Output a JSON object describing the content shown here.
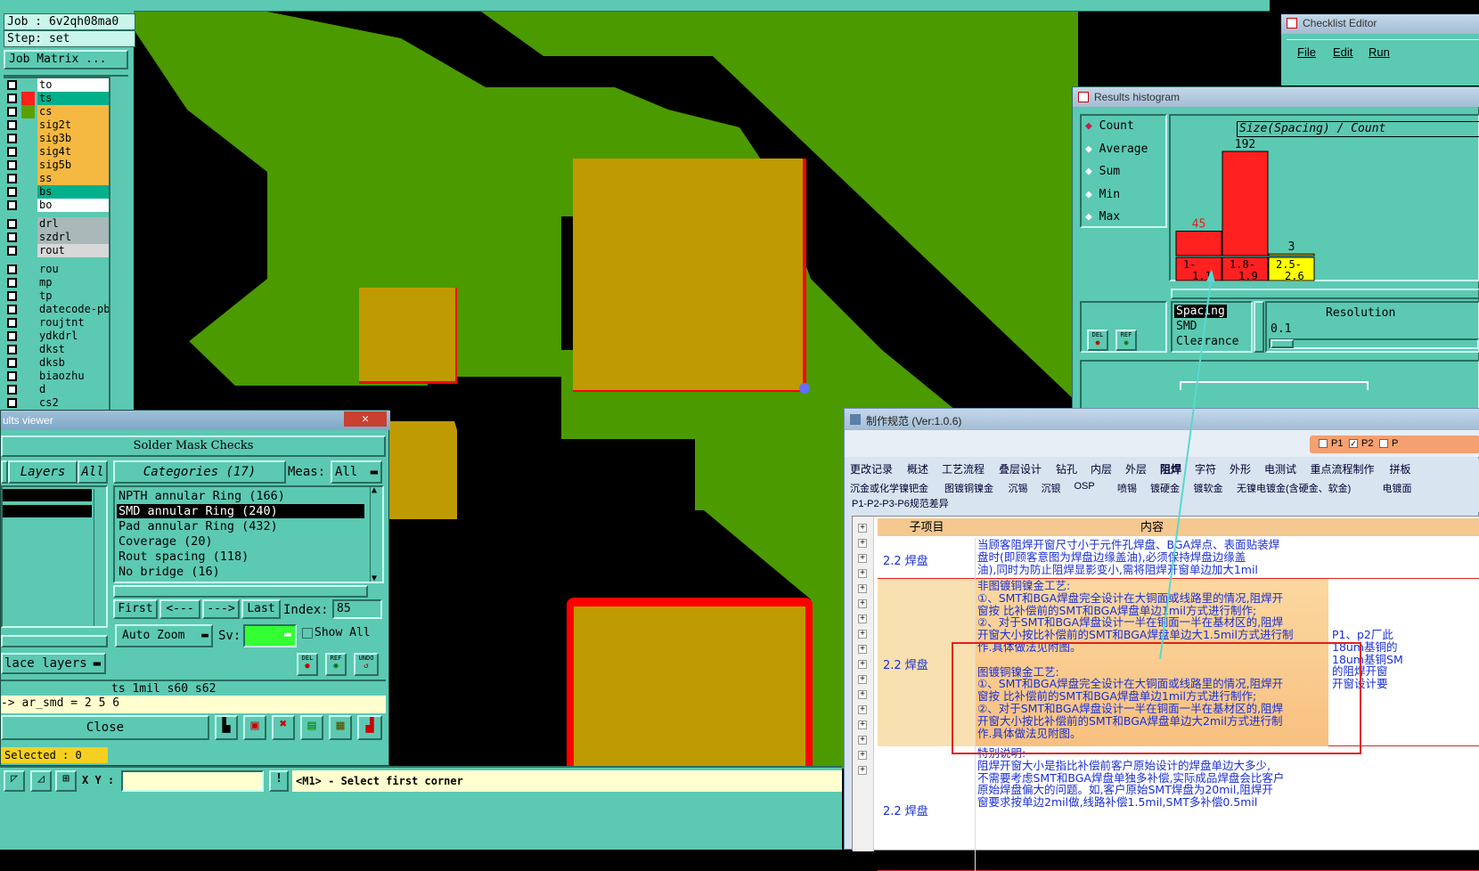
{
  "left_panel": {
    "job": "Job : 6v2qh08ma0",
    "step": "Step: set",
    "job_matrix": "Job Matrix ...",
    "layers": [
      {
        "name": "to",
        "color": "#ffffff",
        "swatch": "#5cc9b2"
      },
      {
        "name": "ts",
        "color": "#00b08a",
        "swatch": "#ff2020"
      },
      {
        "name": "cs",
        "color": "#f5b942",
        "swatch": "#5aa000"
      },
      {
        "name": "sig2t",
        "color": "#f5b942",
        "swatch": "#5cc9b2"
      },
      {
        "name": "sig3b",
        "color": "#f5b942",
        "swatch": "#5cc9b2"
      },
      {
        "name": "sig4t",
        "color": "#f5b942",
        "swatch": "#5cc9b2"
      },
      {
        "name": "sig5b",
        "color": "#f5b942",
        "swatch": "#5cc9b2"
      },
      {
        "name": "ss",
        "color": "#f5b942",
        "swatch": "#5cc9b2"
      },
      {
        "name": "bs",
        "color": "#00b08a",
        "swatch": "#5cc9b2"
      },
      {
        "name": "bo",
        "color": "#ffffff",
        "swatch": "#5cc9b2"
      },
      {
        "name": "drl",
        "color": "#a9b8b8",
        "swatch": "#5cc9b2"
      },
      {
        "name": "szdrl",
        "color": "#a9b8b8",
        "swatch": "#5cc9b2"
      },
      {
        "name": "rout",
        "color": "#d8d8d8",
        "swatch": "#5cc9b2"
      },
      {
        "name": "rou",
        "color": "#5cc9b2",
        "swatch": "#5cc9b2"
      },
      {
        "name": "mp",
        "color": "#5cc9b2",
        "swatch": "#5cc9b2"
      },
      {
        "name": "tp",
        "color": "#5cc9b2",
        "swatch": "#5cc9b2"
      },
      {
        "name": "datecode-pbe",
        "color": "#5cc9b2",
        "swatch": "#5cc9b2"
      },
      {
        "name": "roujtnt",
        "color": "#5cc9b2",
        "swatch": "#5cc9b2"
      },
      {
        "name": "ydkdrl",
        "color": "#5cc9b2",
        "swatch": "#5cc9b2"
      },
      {
        "name": "dkst",
        "color": "#5cc9b2",
        "swatch": "#5cc9b2"
      },
      {
        "name": "dksb",
        "color": "#5cc9b2",
        "swatch": "#5cc9b2"
      },
      {
        "name": "biaozhu",
        "color": "#5cc9b2",
        "swatch": "#5cc9b2"
      },
      {
        "name": "d",
        "color": "#5cc9b2",
        "swatch": "#5cc9b2"
      },
      {
        "name": "cs2",
        "color": "#5cc9b2",
        "swatch": "#5cc9b2"
      }
    ]
  },
  "results_viewer": {
    "title": "ults viewer",
    "header": "Solder Mask Checks",
    "layers_btn": "Layers",
    "all_btn": "All",
    "categories_btn": "Categories (17)",
    "meas_label": "Meas:",
    "meas_value": "All",
    "categories": [
      "NPTH annular Ring (166)",
      "SMD annular Ring (240)",
      "Pad annular Ring (432)",
      "Coverage (20)",
      "Rout spacing (118)",
      "No bridge (16)"
    ],
    "selected_category": 1,
    "first": "First",
    "prev": "<---",
    "next": "--->",
    "last": "Last",
    "index_label": "Index:",
    "index_value": "85",
    "auto_zoom": "Auto Zoom",
    "sv_label": "Sv:",
    "show_all": "Show All",
    "place_layers": "lace layers",
    "info_line": "ts 1mil   s60   s62",
    "formula": "-> ar_smd = 2 5 6",
    "close": "Close",
    "selected": "Selected : 0",
    "del": "DEL",
    "ref": "REF",
    "undo": "UNDO"
  },
  "status_bar": {
    "xy_label": "X Y :",
    "message": "<M1> - Select first corner"
  },
  "checklist": {
    "title": "Checklist Editor",
    "menu": [
      "File",
      "Edit",
      "Run"
    ]
  },
  "histogram": {
    "title": "Results histogram",
    "modes": [
      "Count",
      "Average",
      "Sum",
      "Min",
      "Max"
    ],
    "selected_mode": 0,
    "chart_title": "Size(Spacing) / Count",
    "list": [
      "Spacing",
      "SMD",
      "Clearance"
    ],
    "resolution_label": "Resolution",
    "resolution_value": "0.1",
    "del": "DEL",
    "ref": "REF"
  },
  "chart_data": {
    "type": "bar",
    "title": "Size(Spacing) / Count",
    "categories": [
      "1-1.1",
      "1.8-1.9",
      "2.5-2.6"
    ],
    "category_labels": [
      [
        "1-",
        "1.1"
      ],
      [
        "1.8-",
        "1.9"
      ],
      [
        "2.5-",
        "2.6"
      ]
    ],
    "values": [
      45,
      192,
      3
    ],
    "colors": [
      "#ff2020",
      "#ff2020",
      "#ffff00"
    ],
    "ylim": [
      0,
      192
    ]
  },
  "doc": {
    "title": "制作规范 (Ver:1.0.6)",
    "p_checks": [
      "P1",
      "P2",
      "P"
    ],
    "tabs_row1": [
      "更改记录",
      "概述",
      "工艺流程",
      "叠层设计",
      "钻孔",
      "内层",
      "外层",
      "阻焊",
      "字符",
      "外形",
      "电测试",
      "重点流程制作",
      "拼板"
    ],
    "active_tab": "阻焊",
    "tabs_row2": [
      "沉金或化学镍钯金",
      "图镀铜镍金",
      "沉锡",
      "沉银",
      "OSP",
      "喷锡",
      "镀硬金",
      "镀软金",
      "无镍电镀金(含硬金、软金)",
      "电镀面"
    ],
    "sub_title": "P1-P2-P3-P6规范差异",
    "col_sub": "子项目",
    "col_content": "内容",
    "rows": [
      {
        "item": "2.2 焊盘",
        "lines": [
          "当顾客阻焊开窗尺寸小于元件孔焊盘、BGA焊点、表面贴装焊",
          "盘时(即顾客意图为焊盘边缘盖油),必须保持焊盘边缘盖",
          "油),同时为防止阻焊显影变小,需将阻焊开窗单边加大1mil"
        ]
      },
      {
        "item": "2.2 焊盘",
        "lines": [
          "非图镀铜镍金工艺:",
          "①、SMT和BGA焊盘完全设计在大铜面或线路里的情况,阻焊开",
          "窗按 比补偿前的SMT和BGA焊盘单边1mil方式进行制作;",
          "②、对于SMT和BGA焊盘设计一半在铜面一半在基材区的,阻焊",
          "开窗大小按比补偿前的SMT和BGA焊盘单边大1.5mil方式进行制",
          "作.具体做法见附图。",
          "",
          "图镀铜镍金工艺:",
          "①、SMT和BGA焊盘完全设计在大铜面或线路里的情况,阻焊开",
          "窗按 比补偿前的SMT和BGA焊盘单边1mil方式进行制作;",
          "②、对于SMT和BGA焊盘设计一半在铜面一半在基材区的,阻焊",
          "开窗大小按比补偿前的SMT和BGA焊盘单边大2mil方式进行制",
          "作.具体做法见附图。"
        ],
        "side": [
          "P1、p2厂此",
          "18um基铜的",
          "18um基铜SM",
          "的阻焊开窗",
          "开窗设计要"
        ]
      },
      {
        "item": "2.2 焊盘",
        "lines": [
          "特别说明:",
          "阻焊开窗大小是指比补偿前客户原始设计的焊盘单边大多少,",
          "不需要考虑SMT和BGA焊盘单独多补偿,实际成品焊盘会比客户",
          "原始焊盘偏大的问题。如,客户原始SMT焊盘为20mil,阻焊开",
          "窗要求按单边2mil做,线路补偿1.5mil,SMT多补偿0.5mil"
        ]
      }
    ]
  }
}
